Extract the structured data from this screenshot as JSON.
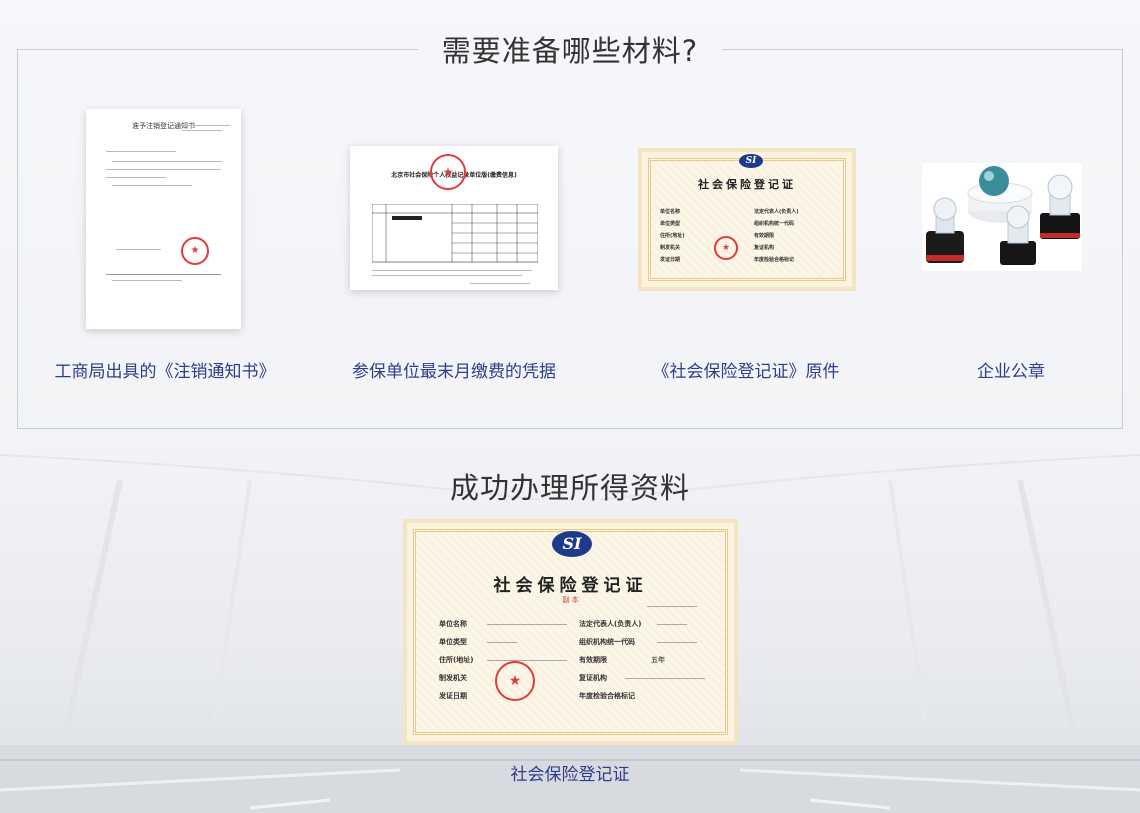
{
  "section1": {
    "title": "需要准备哪些材料?",
    "items": [
      {
        "caption": "工商局出具的《注销通知书》"
      },
      {
        "caption": "参保单位最末月缴费的凭据"
      },
      {
        "caption": "《社会保险登记证》原件"
      },
      {
        "caption": "企业公章"
      }
    ]
  },
  "doc_notice": {
    "title": "准予注销登记通知书"
  },
  "receipt": {
    "title": "北京市社会保险个人权益记录单位版(缴费信息)"
  },
  "certificate": {
    "logo": "SI",
    "title": "社会保险登记证",
    "subtitle": "副  本",
    "labels": {
      "unit_name": "单位名称",
      "unit_type": "单位类型",
      "address": "住所(地址)",
      "issuer": "制发机关",
      "issue_date": "发证日期",
      "legal_rep": "法定代表人(负责人)",
      "org_code": "组织机构统一代码",
      "valid_period": "有效期限",
      "verifier": "复证机构",
      "annual_check": "年度检验合格标记"
    },
    "values": {
      "valid_period": "五年"
    }
  },
  "section2": {
    "title": "成功办理所得资料",
    "caption": "社会保险登记证"
  }
}
